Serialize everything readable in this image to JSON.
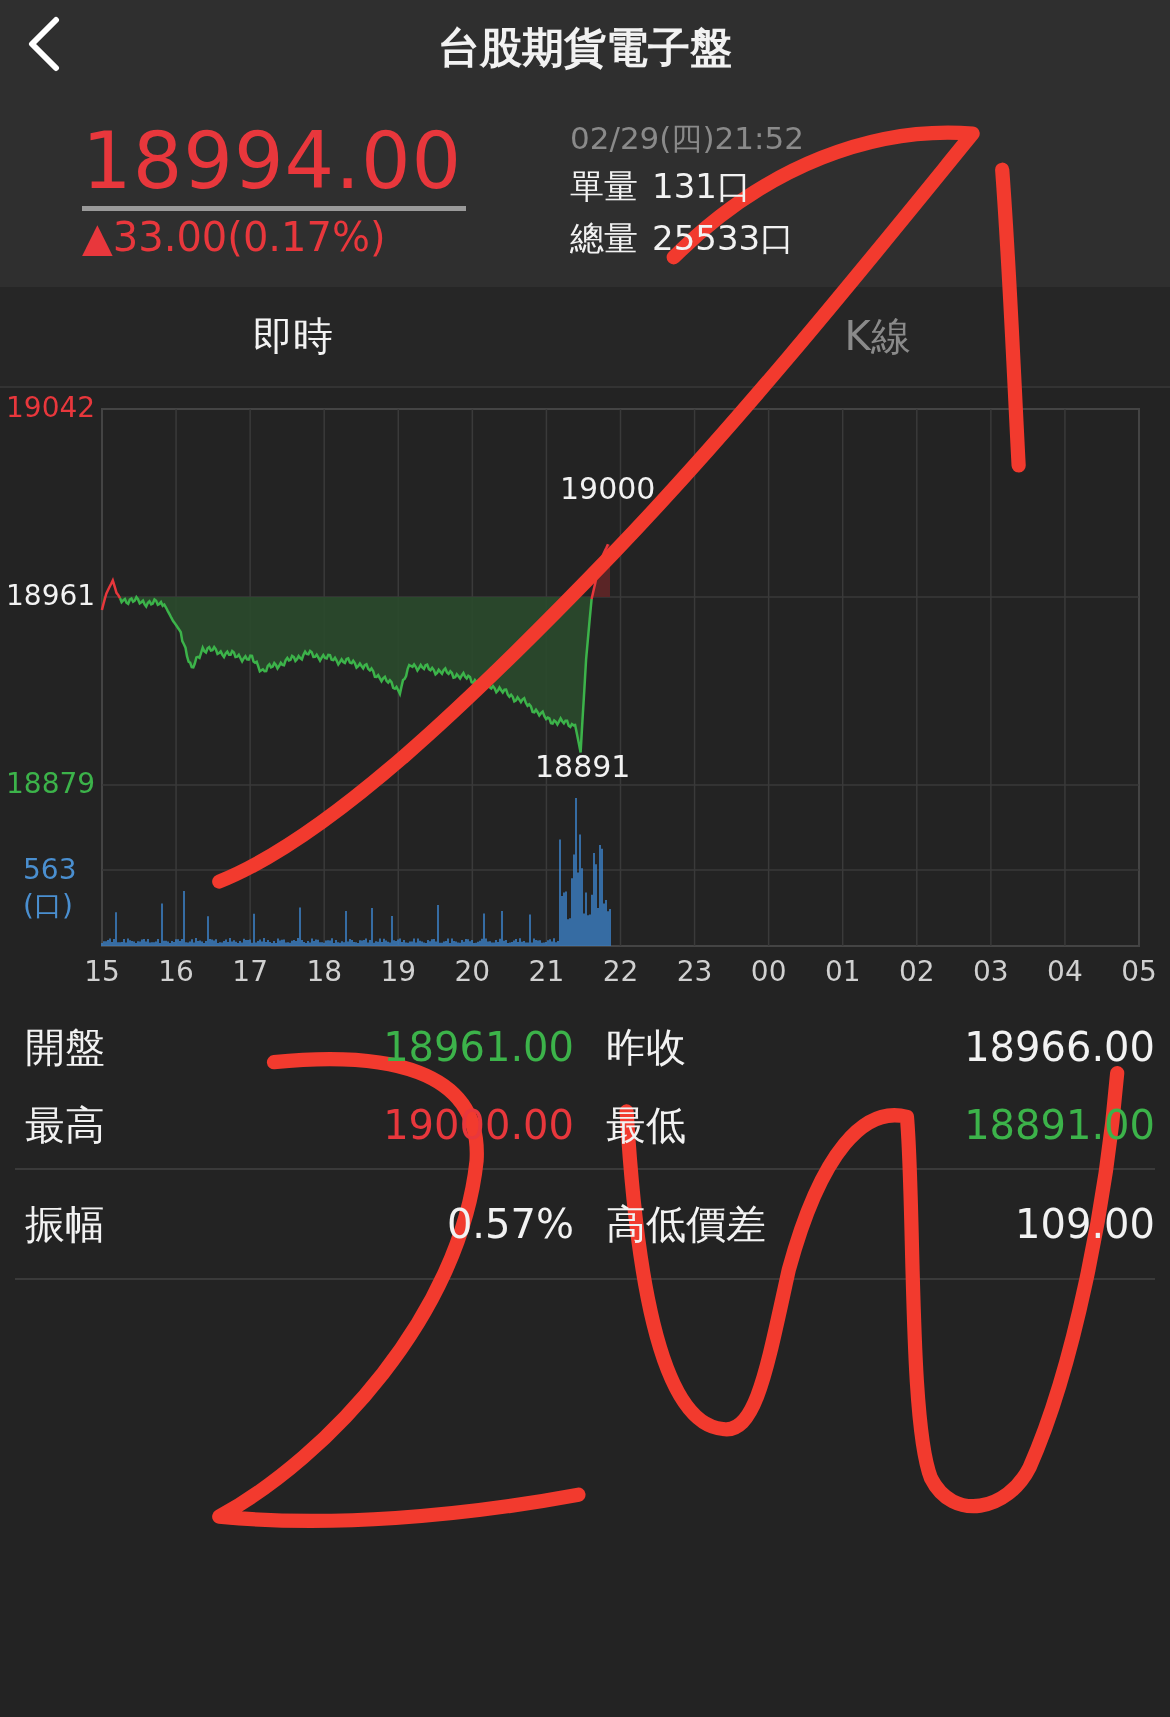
{
  "header": {
    "title": "台股期貨電子盤"
  },
  "quote": {
    "price": "18994.00",
    "change": "▲33.00(0.17%)",
    "color": "#e8373c",
    "time": "02/29(四)21:52",
    "volumes": [
      {
        "label": "單量",
        "value": "131口"
      },
      {
        "label": "總量",
        "value": "25533口"
      }
    ]
  },
  "tabs": [
    {
      "label": "即時",
      "selected": true
    },
    {
      "label": "K線",
      "selected": false
    }
  ],
  "chart": {
    "y_labels": [
      {
        "text": "19042",
        "kind": "high"
      },
      {
        "text": "18961",
        "kind": "base"
      },
      {
        "text": "18879",
        "kind": "low"
      }
    ],
    "volume_label": "563",
    "volume_unit": "(口)",
    "peak_label": "19000",
    "trough_label": "18891",
    "x_labels": [
      "15",
      "16",
      "17",
      "18",
      "19",
      "20",
      "21",
      "22",
      "23",
      "00",
      "01",
      "02",
      "03",
      "04",
      "05"
    ]
  },
  "stat_groups": [
    {
      "rows": [
        [
          {
            "label": "開盤",
            "value": "18961.00",
            "color": "#3cb34a"
          },
          {
            "label": "昨收",
            "value": "18966.00",
            "color": "#f2f2f2"
          }
        ],
        [
          {
            "label": "最高",
            "value": "19000.00",
            "color": "#e8373c"
          },
          {
            "label": "最低",
            "value": "18891.00",
            "color": "#3cb34a"
          }
        ]
      ]
    },
    {
      "rows": [
        [
          {
            "label": "振幅",
            "value": "0.57%",
            "color": "#f2f2f2"
          },
          {
            "label": "高低價差",
            "value": "109.00",
            "color": "#f2f2f2"
          }
        ]
      ]
    }
  ]
}
